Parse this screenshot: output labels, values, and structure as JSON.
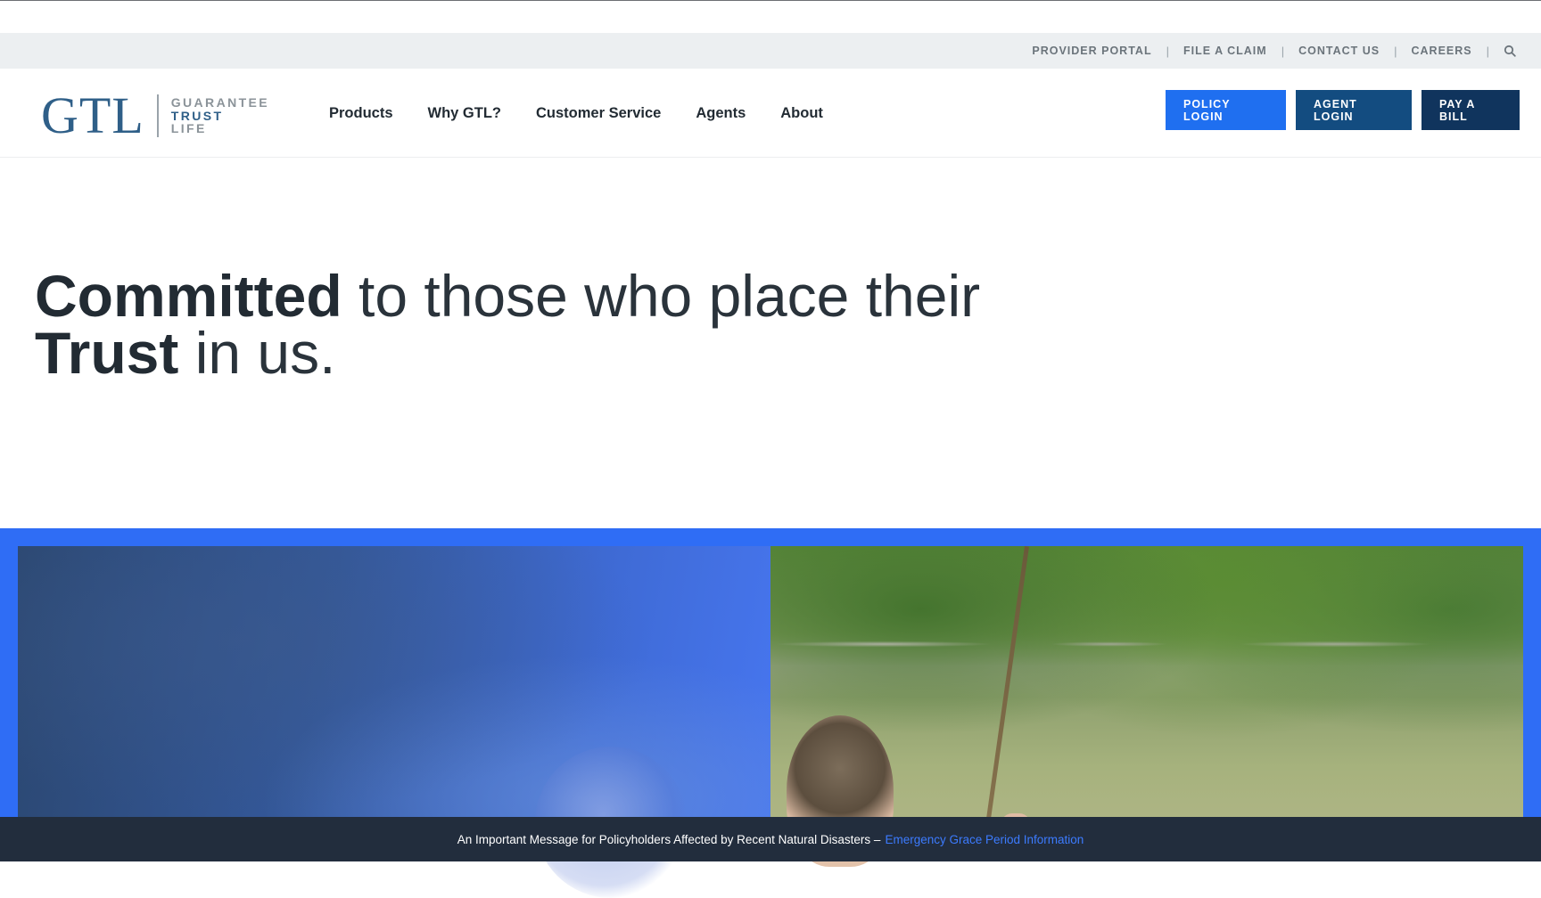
{
  "utility_nav": {
    "items": [
      "PROVIDER PORTAL",
      "FILE A CLAIM",
      "CONTACT US",
      "CAREERS"
    ],
    "separator": "|"
  },
  "logo": {
    "mark": "GTL",
    "word1": "GUARANTEE",
    "word2": "TRUST",
    "word3": "LIFE"
  },
  "primary_nav": {
    "items": [
      "Products",
      "Why GTL?",
      "Customer Service",
      "Agents",
      "About"
    ]
  },
  "header_buttons": {
    "policy_login": "POLICY LOGIN",
    "agent_login": "AGENT LOGIN",
    "pay_bill": "PAY A BILL"
  },
  "hero": {
    "line1_bold": "Committed",
    "line1_rest": " to those who place their",
    "line2_bold": "Trust",
    "line2_rest": " in us."
  },
  "alert": {
    "message": "An Important Message for Policyholders Affected by Recent Natural Disasters –",
    "link": "Emergency Grace Period Information"
  },
  "colors": {
    "policy_button": "#1f6ff0",
    "agent_button": "#134c80",
    "pay_button": "#10345d",
    "frame_blue": "#2f6df5",
    "alert_bg": "#222d3d",
    "alert_link": "#3c7bff",
    "logo_blue": "#2f5f88"
  }
}
